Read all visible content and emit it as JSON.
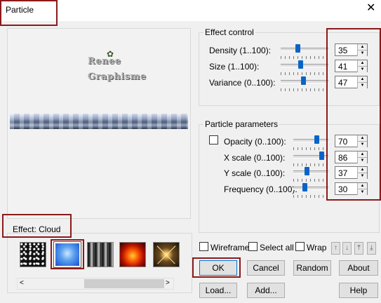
{
  "window": {
    "title": "Particle",
    "close_glyph": "✕"
  },
  "preview": {
    "logo_line1": "Renee",
    "logo_line2": "Graphisme",
    "leaf_icon": "leaf-icon"
  },
  "effect": {
    "label": "Effect: Cloud",
    "selected_index": 1,
    "thumbnails": [
      "stars",
      "cloud",
      "streaks",
      "fire",
      "starburst"
    ]
  },
  "scrollbar": {
    "left_glyph": "<",
    "right_glyph": ">"
  },
  "effect_control": {
    "title": "Effect control",
    "density": {
      "label": "Density (1..100):",
      "value": "35",
      "level": 35
    },
    "size": {
      "label": "Size (1..100):",
      "value": "41",
      "level": 41
    },
    "variance": {
      "label": "Variance (0..100):",
      "value": "47",
      "level": 47
    }
  },
  "particle_parameters": {
    "title": "Particle parameters",
    "opacity": {
      "label": "Opacity (0..100):",
      "value": "70",
      "level": 70,
      "checked": false
    },
    "xscale": {
      "label": "X scale (0..100):",
      "value": "86",
      "level": 86
    },
    "yscale": {
      "label": "Y scale (0..100):",
      "value": "37",
      "level": 37
    },
    "frequency": {
      "label": "Frequency (0..100):",
      "value": "30",
      "level": 30
    }
  },
  "options": {
    "wireframe": "Wireframe",
    "select_all": "Select all",
    "wrap": "Wrap"
  },
  "buttons": {
    "ok": "OK",
    "cancel": "Cancel",
    "random": "Random",
    "about": "About",
    "load": "Load...",
    "add": "Add...",
    "help": "Help"
  },
  "arrows": {
    "up": "↑",
    "down": "↓",
    "top": "⤒",
    "bottom": "⤓"
  },
  "colors": {
    "annotation_red": "#8b1a1a",
    "slider_blue": "#0a64c8"
  }
}
